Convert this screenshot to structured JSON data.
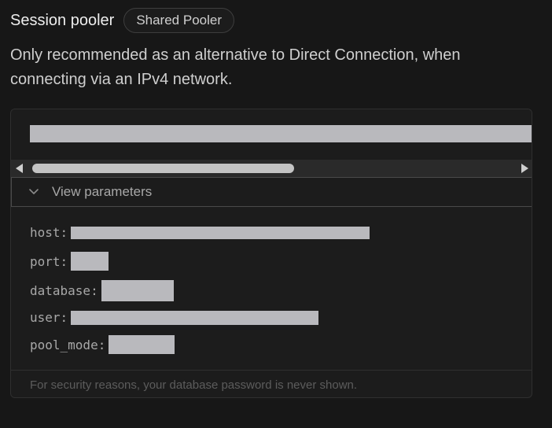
{
  "header": {
    "title": "Session pooler",
    "badge": "Shared Pooler"
  },
  "description": "Only recommended as an alternative to Direct Connection, when connecting via an IPv4 network.",
  "connection": {
    "string_redacted": true
  },
  "parameters": {
    "toggle_label": "View parameters",
    "items": [
      {
        "key": "host:",
        "value_redacted": true
      },
      {
        "key": "port:",
        "value_redacted": true
      },
      {
        "key": "database:",
        "value_redacted": true
      },
      {
        "key": "user:",
        "value_redacted": true
      },
      {
        "key": "pool_mode:",
        "value_redacted": true
      }
    ]
  },
  "footer": {
    "note": "For security reasons, your database password is never shown."
  },
  "icons": {
    "toggle": "chevron-down-icon",
    "scroll_left": "arrow-left-icon",
    "scroll_right": "arrow-right-icon"
  },
  "colors": {
    "background": "#171717",
    "panel": "#1c1c1c",
    "redaction": "#b9b9bd"
  }
}
